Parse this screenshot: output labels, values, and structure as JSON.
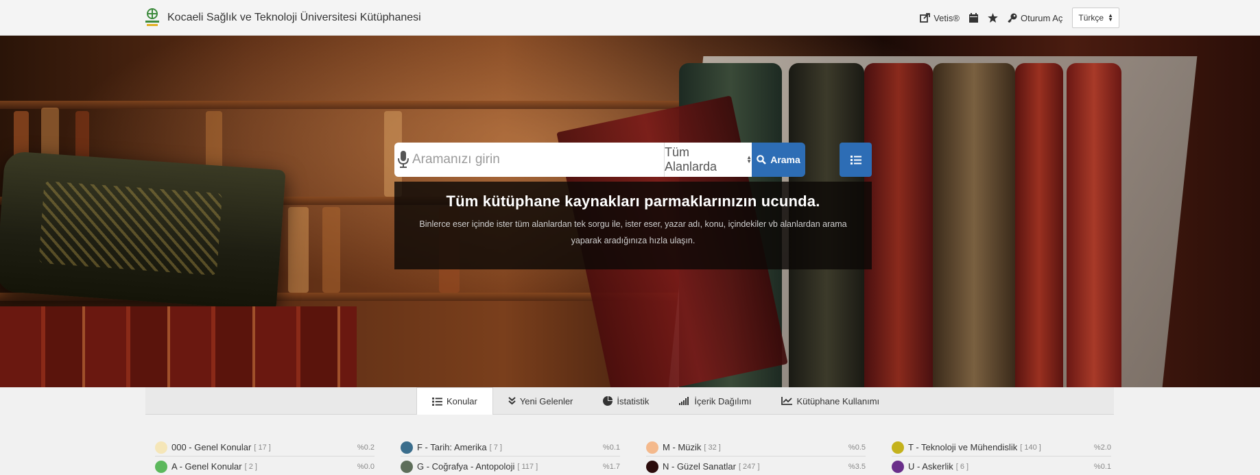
{
  "header": {
    "title": "Kocaeli Sağlık ve Teknoloji Üniversitesi Kütüphanesi",
    "nav": {
      "vetis": "Vetis®",
      "login": "Oturum Aç",
      "language": "Türkçe"
    }
  },
  "search": {
    "placeholder": "Aramanızı girin",
    "scope": "Tüm Alanlarda",
    "button": "Arama"
  },
  "hero": {
    "title": "Tüm kütüphane kaynakları parmaklarınızın ucunda.",
    "description": "Binlerce eser içinde ister tüm alanlardan tek sorgu ile, ister eser, yazar adı, konu, içindekiler vb alanlardan arama yaparak aradığınıza hızla ulaşın."
  },
  "tabs": [
    {
      "label": "Konular",
      "icon": "list-icon",
      "active": true
    },
    {
      "label": "Yeni Gelenler",
      "icon": "double-chevron-down-icon",
      "active": false
    },
    {
      "label": "İstatistik",
      "icon": "pie-chart-icon",
      "active": false
    },
    {
      "label": "İçerik Dağılımı",
      "icon": "bar-signal-icon",
      "active": false
    },
    {
      "label": "Kütüphane Kullanımı",
      "icon": "line-chart-icon",
      "active": false
    }
  ],
  "categories": [
    {
      "name": "000 - Genel Konular",
      "count": "[ 17 ]",
      "percent": "%0.2",
      "color": "#f5e6b8"
    },
    {
      "name": "A - Genel Konular",
      "count": "[ 2 ]",
      "percent": "%0.0",
      "color": "#5cb85c"
    },
    {
      "name": "F - Tarih: Amerika",
      "count": "[ 7 ]",
      "percent": "%0.1",
      "color": "#3a6d8c"
    },
    {
      "name": "G - Coğrafya - Antopoloji",
      "count": "[ 117 ]",
      "percent": "%1.7",
      "color": "#5e6e5a"
    },
    {
      "name": "M - Müzik",
      "count": "[ 32 ]",
      "percent": "%0.5",
      "color": "#f4b98c"
    },
    {
      "name": "N - Güzel Sanatlar",
      "count": "[ 247 ]",
      "percent": "%3.5",
      "color": "#2b0c0c"
    },
    {
      "name": "T - Teknoloji ve Mühendislik",
      "count": "[ 140 ]",
      "percent": "%2.0",
      "color": "#c4b21c"
    },
    {
      "name": "U - Askerlik",
      "count": "[ 6 ]",
      "percent": "%0.1",
      "color": "#6a2f8a"
    }
  ]
}
